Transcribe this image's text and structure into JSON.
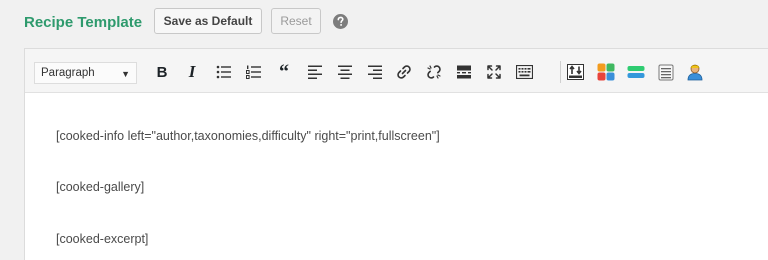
{
  "header": {
    "title": "Recipe Template",
    "save_default_label": "Save as Default",
    "reset_label": "Reset"
  },
  "toolbar": {
    "format_select": "Paragraph",
    "buttons": [
      "bold-icon",
      "italic-icon",
      "bullet-list-icon",
      "numbered-list-icon",
      "blockquote-icon",
      "align-left-icon",
      "align-center-icon",
      "align-right-icon",
      "link-icon",
      "unlink-icon",
      "read-more-icon",
      "fullscreen-icon",
      "toolbar-toggle-icon",
      "cooked-shortcode-icon",
      "cooked-ingredients-icon",
      "cooked-directions-icon",
      "cooked-notes-icon",
      "cooked-author-icon"
    ]
  },
  "content": {
    "lines": [
      "[cooked-info left=\"author,taxonomies,difficulty\" right=\"print,fullscreen\"]",
      "[cooked-gallery]",
      "[cooked-excerpt]"
    ]
  },
  "colors": {
    "title": "#2e9a6d",
    "background": "#f1f1f1",
    "toolbar": "#f5f5f5",
    "editor": "#ffffff"
  }
}
